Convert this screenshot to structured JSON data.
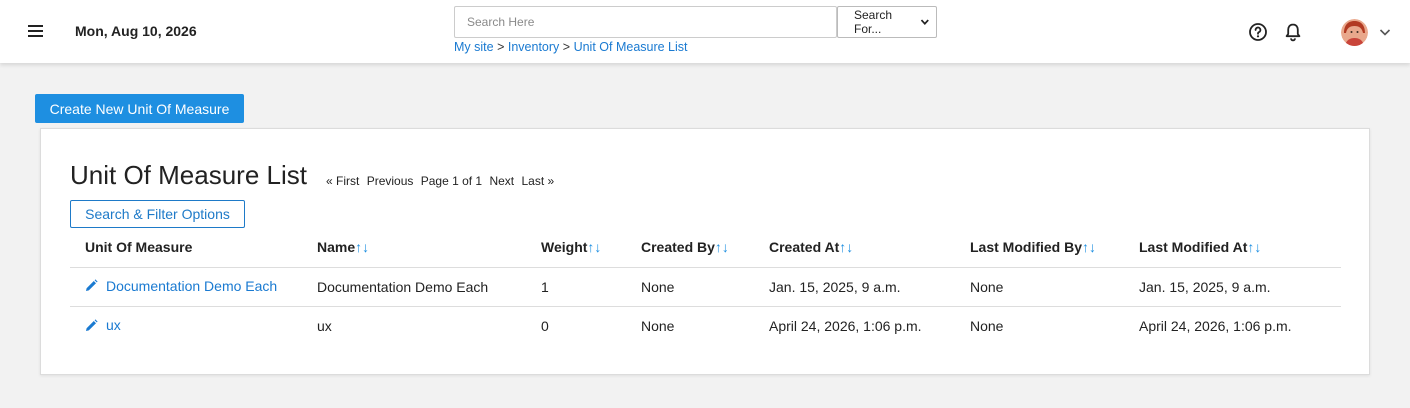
{
  "header": {
    "date": "Mon, Aug 10, 2026",
    "search_placeholder": "Search Here",
    "search_select": "Search For...",
    "breadcrumb": [
      "My site",
      "Inventory",
      "Unit Of Measure List"
    ],
    "breadcrumb_sep": ">",
    "icons": [
      "menu-icon",
      "help-icon",
      "bell-icon",
      "avatar",
      "chevron-down-icon"
    ]
  },
  "actions": {
    "create_label": "Create New Unit Of Measure"
  },
  "list": {
    "title": "Unit Of Measure List",
    "pager": {
      "first": "« First",
      "previous": "Previous",
      "page_info": "Page 1 of 1",
      "next": "Next",
      "last": "Last »"
    },
    "filter_label": "Search & Filter Options",
    "sort_glyph": "↑↓",
    "columns": [
      "Unit Of Measure",
      "Name",
      "Weight",
      "Created By",
      "Created At",
      "Last Modified By",
      "Last Modified At"
    ],
    "rows": [
      {
        "uom": "Documentation Demo Each",
        "name": "Documentation Demo Each",
        "weight": "1",
        "created_by": "None",
        "created_at": "Jan. 15, 2025, 9 a.m.",
        "modified_by": "None",
        "modified_at": "Jan. 15, 2025, 9 a.m."
      },
      {
        "uom": "ux",
        "name": "ux",
        "weight": "0",
        "created_by": "None",
        "created_at": "April 24, 2026, 1:06 p.m.",
        "modified_by": "None",
        "modified_at": "April 24, 2026, 1:06 p.m."
      }
    ]
  },
  "colors": {
    "accent": "#1e8fe1",
    "link": "#1a7ad1",
    "background": "#f2f2f2"
  }
}
